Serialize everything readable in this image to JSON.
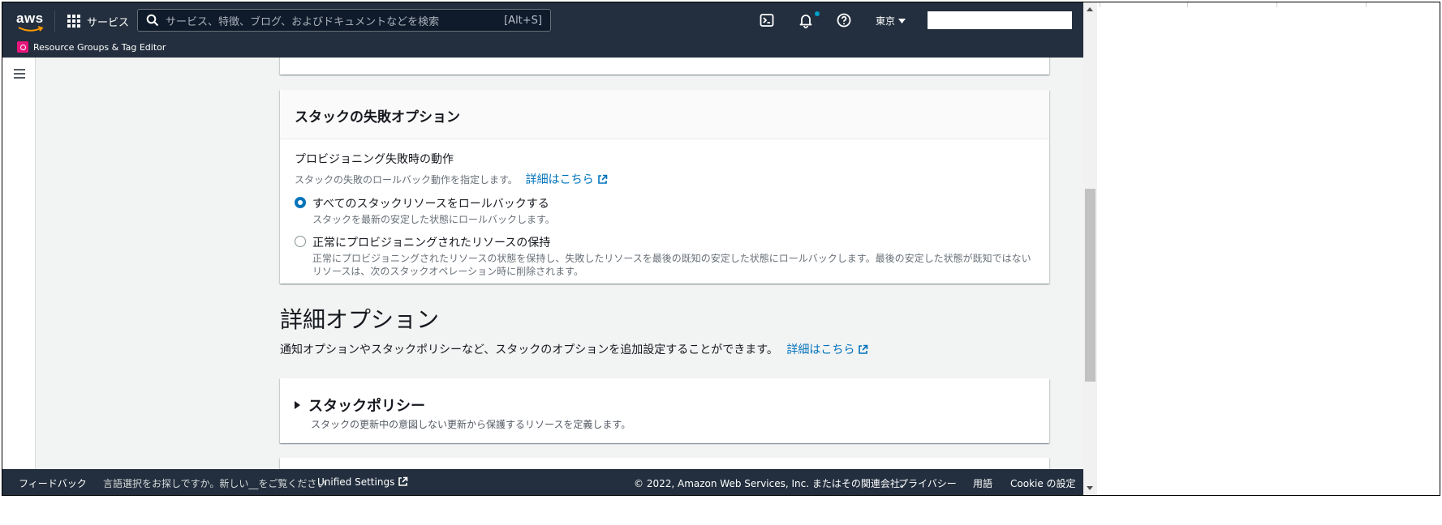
{
  "topnav": {
    "logo": "aws",
    "services_label": "サービス",
    "search_placeholder": "サービス、特徴、ブログ、およびドキュメントなどを検索",
    "search_shortcut": "[Alt+S]",
    "region": "東京",
    "favorites": [
      {
        "label": "Resource Groups & Tag Editor"
      }
    ]
  },
  "failure_options": {
    "title": "スタックの失敗オプション",
    "field_label": "プロビジョニング失敗時の動作",
    "field_desc": "スタックの失敗のロールバック動作を指定します。",
    "learn_more": "詳細はこちら",
    "options": [
      {
        "label": "すべてのスタックリソースをロールバックする",
        "desc": "スタックを最新の安定した状態にロールバックします。",
        "selected": true
      },
      {
        "label": "正常にプロビジョニングされたリソースの保持",
        "desc": "正常にプロビジョニングされたリソースの状態を保持し、失敗したリソースを最後の既知の安定した状態にロールバックします。最後の安定した状態が既知ではないリソースは、次のスタックオペレーション時に削除されます。",
        "selected": false
      }
    ]
  },
  "advanced": {
    "title": "詳細オプション",
    "desc": "通知オプションやスタックポリシーなど、スタックのオプションを追加設定することができます。",
    "learn_more": "詳細はこちら"
  },
  "stack_policy": {
    "title": "スタックポリシー",
    "desc": "スタックの更新中の意図しない更新から保護するリソースを定義します。"
  },
  "footer": {
    "feedback": "フィードバック",
    "language_prompt": "言語選択をお探しですか。新しい__をご覧ください",
    "unified_settings": "Unified Settings",
    "copyright": "© 2022, Amazon Web Services, Inc. またはその関連会社。",
    "privacy": "プライバシー",
    "terms": "用語",
    "cookie": "Cookie の設定"
  },
  "colors": {
    "nav_bg": "#232f3e",
    "link": "#0073bb",
    "page_bg": "#f2f3f3",
    "favorite_icon": "#e7157b",
    "notification_dot": "#00a1c9"
  },
  "icons": [
    "aws-logo",
    "services-grid-icon",
    "search-icon",
    "cloudshell-icon",
    "bell-icon",
    "help-icon",
    "caret-down-icon",
    "resource-groups-icon",
    "hamburger-icon",
    "external-link-icon",
    "expand-triangle-icon"
  ]
}
